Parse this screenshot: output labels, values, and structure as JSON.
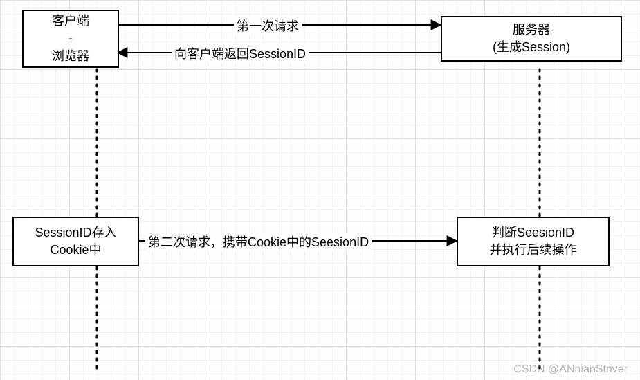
{
  "client": {
    "line1": "客户端",
    "line2": "-",
    "line3": "浏览器"
  },
  "server": {
    "line1": "服务器",
    "line2": "(生成Session)"
  },
  "cookieStore": {
    "line1": "SessionID存入",
    "line2": "Cookie中"
  },
  "verify": {
    "line1": "判断SeesionID",
    "line2": "并执行后续操作"
  },
  "edges": {
    "firstRequest": "第一次请求",
    "returnSession": "向客户端返回SessionID",
    "secondRequest": "第二次请求，携带Cookie中的SeesionID"
  },
  "watermark": "CSDN @ANnianStriver"
}
